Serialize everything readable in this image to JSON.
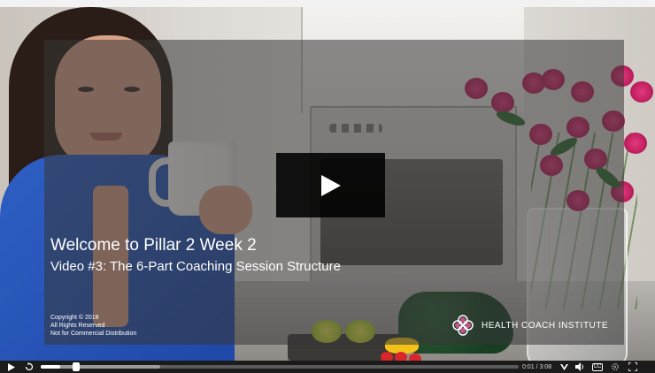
{
  "video": {
    "title": "Welcome to Pillar 2 Week 2",
    "subtitle": "Video #3: The 6-Part Coaching Session Structure",
    "copyright_lines": [
      "Copyright © 2018",
      "All Rights Reserved",
      "Not for Commercial Distribution"
    ],
    "brand_name": "HEALTH COACH INSTITUTE"
  },
  "controls": {
    "time_display": "0:01 / 3:08",
    "progress_fraction": 0.04,
    "buffered_fraction": 0.25,
    "cc_label": "CC",
    "icons": [
      "play-icon",
      "replay-icon",
      "brand-icon",
      "volume-icon",
      "cc-icon",
      "settings-icon",
      "fullscreen-icon"
    ]
  },
  "colors": {
    "overlay": "#373737",
    "control_bar": "#1b1b1b",
    "play_button": "#000000",
    "brand_logo": "#e0569a"
  }
}
